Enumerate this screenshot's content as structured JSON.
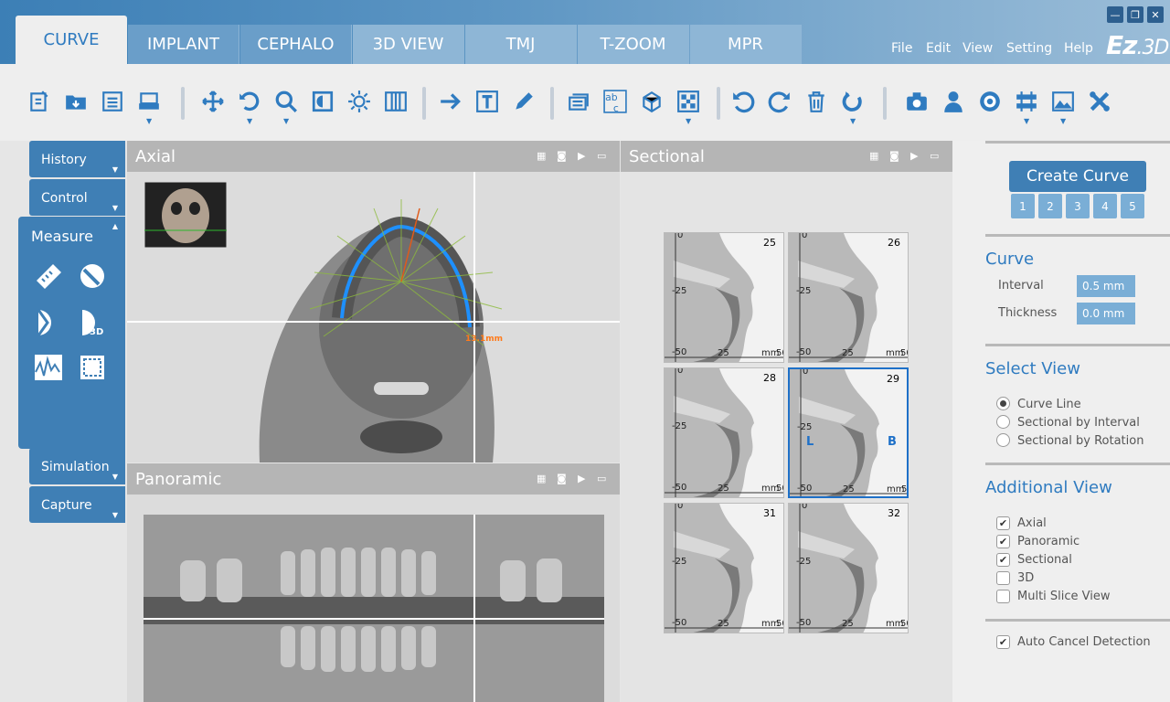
{
  "app": {
    "logo_main": "Ez",
    "logo_sub": "3D"
  },
  "tabs": [
    {
      "label": "CURVE"
    },
    {
      "label": "IMPLANT"
    },
    {
      "label": "CEPHALO"
    },
    {
      "label": "3D VIEW"
    },
    {
      "label": "TMJ"
    },
    {
      "label": "T-ZOOM"
    },
    {
      "label": "MPR"
    }
  ],
  "menu": [
    "File",
    "Edit",
    "View",
    "Setting",
    "Help"
  ],
  "window": {
    "minimize": "—",
    "restore": "❐",
    "close": "✕"
  },
  "sidebar": {
    "history": "History",
    "control": "Control",
    "measure": "Measure",
    "simulation": "Simulation",
    "capture": "Capture"
  },
  "panels": {
    "axial": "Axial",
    "panoramic": "Panoramic",
    "sectional": "Sectional",
    "measure_text": "13.1mm"
  },
  "sectional": {
    "slices": [
      "25",
      "26",
      "28",
      "29",
      "31",
      "32"
    ],
    "ticks": {
      "t0": "0",
      "t25": "-25",
      "t50": "-50",
      "x25": "25",
      "x50": "50",
      "unit": "mm"
    },
    "lingual": "L",
    "buccal": "B"
  },
  "right": {
    "create_curve": "Create Curve",
    "presets": [
      "1",
      "2",
      "3",
      "4",
      "5"
    ],
    "curve_title": "Curve",
    "interval_label": "Interval",
    "interval_value": "0.5 mm",
    "thickness_label": "Thickness",
    "thickness_value": "0.0 mm",
    "select_view_title": "Select View",
    "views": [
      "Curve Line",
      "Sectional by Interval",
      "Sectional by Rotation"
    ],
    "additional_title": "Additional View",
    "additional": [
      "Axial",
      "Panoramic",
      "Sectional",
      "3D",
      "Multi Slice View"
    ],
    "auto_cancel": "Auto Cancel Detection"
  },
  "colors": {
    "accent": "#2f7bc0",
    "tab_bar": "#3c7fb6",
    "curve": "#1e90ff"
  }
}
